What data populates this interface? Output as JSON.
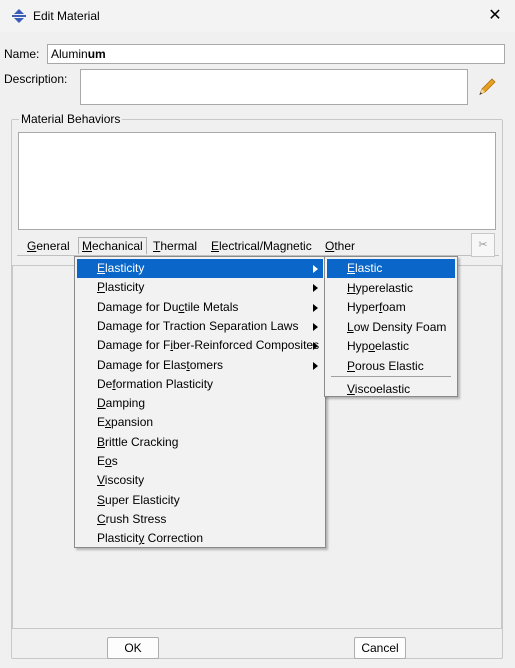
{
  "window": {
    "title": "Edit Material",
    "close_glyph": "✕"
  },
  "form": {
    "name_label": "Name:",
    "name_prefix": "Alumin",
    "name_caret": "um",
    "description_label": "Description:",
    "description_value": "",
    "edit_icon": "pencil-icon"
  },
  "behaviors": {
    "group_label": "Material Behaviors",
    "items": []
  },
  "tabs": [
    {
      "pre": "",
      "key": "G",
      "post": "eneral"
    },
    {
      "pre": "",
      "key": "M",
      "post": "echanical"
    },
    {
      "pre": "",
      "key": "T",
      "post": "hermal"
    },
    {
      "pre": "",
      "key": "E",
      "post": "lectrical/Magnetic"
    },
    {
      "pre": "",
      "key": "O",
      "post": "ther"
    }
  ],
  "mechanical_menu": [
    {
      "pre": "",
      "key": "E",
      "post": "lasticity",
      "submenu": true
    },
    {
      "pre": "",
      "key": "P",
      "post": "lasticity",
      "submenu": true
    },
    {
      "pre": "Damage for Du",
      "key": "c",
      "post": "tile Metals",
      "submenu": true
    },
    {
      "pre": "Dama",
      "key": "g",
      "post": "e for Traction Separation Laws",
      "submenu": true
    },
    {
      "pre": "Damage for F",
      "key": "i",
      "post": "ber-Reinforced Composites",
      "submenu": true
    },
    {
      "pre": "Damage for Elas",
      "key": "t",
      "post": "omers",
      "submenu": true
    },
    {
      "pre": "De",
      "key": "f",
      "post": "ormation Plasticity",
      "submenu": false
    },
    {
      "pre": "",
      "key": "D",
      "post": "amping",
      "submenu": false
    },
    {
      "pre": "E",
      "key": "x",
      "post": "pansion",
      "submenu": false
    },
    {
      "pre": "",
      "key": "B",
      "post": "rittle Cracking",
      "submenu": false
    },
    {
      "pre": "E",
      "key": "o",
      "post": "s",
      "submenu": false
    },
    {
      "pre": "",
      "key": "V",
      "post": "iscosity",
      "submenu": false
    },
    {
      "pre": "",
      "key": "S",
      "post": "uper Elasticity",
      "submenu": false
    },
    {
      "pre": "",
      "key": "C",
      "post": "rush Stress",
      "submenu": false
    },
    {
      "pre": "Plasticit",
      "key": "y",
      "post": " Correction",
      "submenu": false
    }
  ],
  "elasticity_submenu": [
    {
      "pre": "",
      "key": "E",
      "post": "lastic"
    },
    {
      "pre": "",
      "key": "H",
      "post": "yperelastic"
    },
    {
      "pre": "Hyper",
      "key": "f",
      "post": "oam"
    },
    {
      "pre": "",
      "key": "L",
      "post": "ow Density Foam"
    },
    {
      "pre": "Hyp",
      "key": "o",
      "post": "elastic"
    },
    {
      "pre": "",
      "key": "P",
      "post": "orous Elastic"
    },
    {
      "pre": "",
      "key": "V",
      "post": "iscoelastic"
    }
  ],
  "buttons": {
    "ok": "OK",
    "cancel": "Cancel"
  },
  "colors": {
    "highlight": "#0a66c8",
    "title_icon": "#3a5db8",
    "pencil": "#e8a020"
  }
}
